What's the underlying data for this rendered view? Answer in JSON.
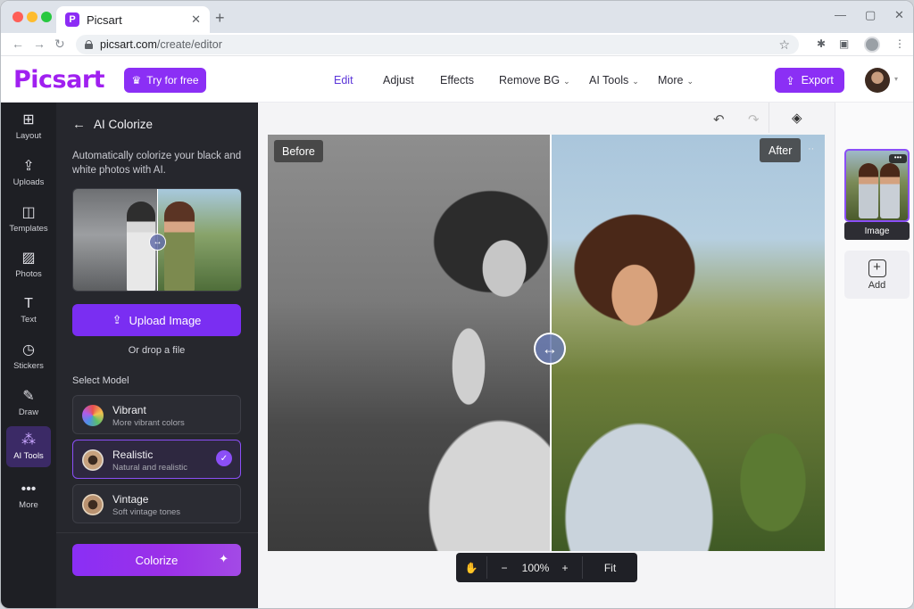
{
  "browser": {
    "tab_title": "Picsart",
    "tab_favicon": "P",
    "url_host": "picsart.com",
    "url_path": "/create/editor"
  },
  "header": {
    "logo": "Picsart",
    "try_label": "Try for free",
    "menu": [
      "Edit",
      "Adjust",
      "Effects",
      "Remove BG",
      "AI Tools",
      "More"
    ],
    "export_label": "Export"
  },
  "sidebar": {
    "items": [
      {
        "label": "Layout",
        "icon": "layout-icon"
      },
      {
        "label": "Uploads",
        "icon": "upload-icon"
      },
      {
        "label": "Templates",
        "icon": "templates-icon"
      },
      {
        "label": "Photos",
        "icon": "photos-icon"
      },
      {
        "label": "Text",
        "icon": "text-icon"
      },
      {
        "label": "Stickers",
        "icon": "stickers-icon"
      },
      {
        "label": "Draw",
        "icon": "draw-icon"
      },
      {
        "label": "AI Tools",
        "icon": "ai-tools-icon"
      },
      {
        "label": "More",
        "icon": "more-icon"
      }
    ],
    "active": "AI Tools"
  },
  "panel": {
    "title": "AI Colorize",
    "description": "Automatically colorize your black and white photos with AI.",
    "upload_label": "Upload Image",
    "drop_label": "Or drop a file",
    "select_model_label": "Select Model",
    "models": [
      {
        "name": "Vibrant",
        "subtitle": "More vibrant colors",
        "selected": false
      },
      {
        "name": "Realistic",
        "subtitle": "Natural and realistic",
        "selected": true
      },
      {
        "name": "Vintage",
        "subtitle": "Soft vintage tones",
        "selected": false
      }
    ],
    "colorize_label": "Colorize"
  },
  "canvas": {
    "before_label": "Before",
    "after_label": "After",
    "zoom": "100%",
    "fit_label": "Fit"
  },
  "pages": {
    "thumb_label": "Image",
    "add_label": "Add"
  },
  "colors": {
    "accent": "#8b2ff5",
    "sidebar_bg": "#1e1f24",
    "panel_bg": "#26272d"
  }
}
